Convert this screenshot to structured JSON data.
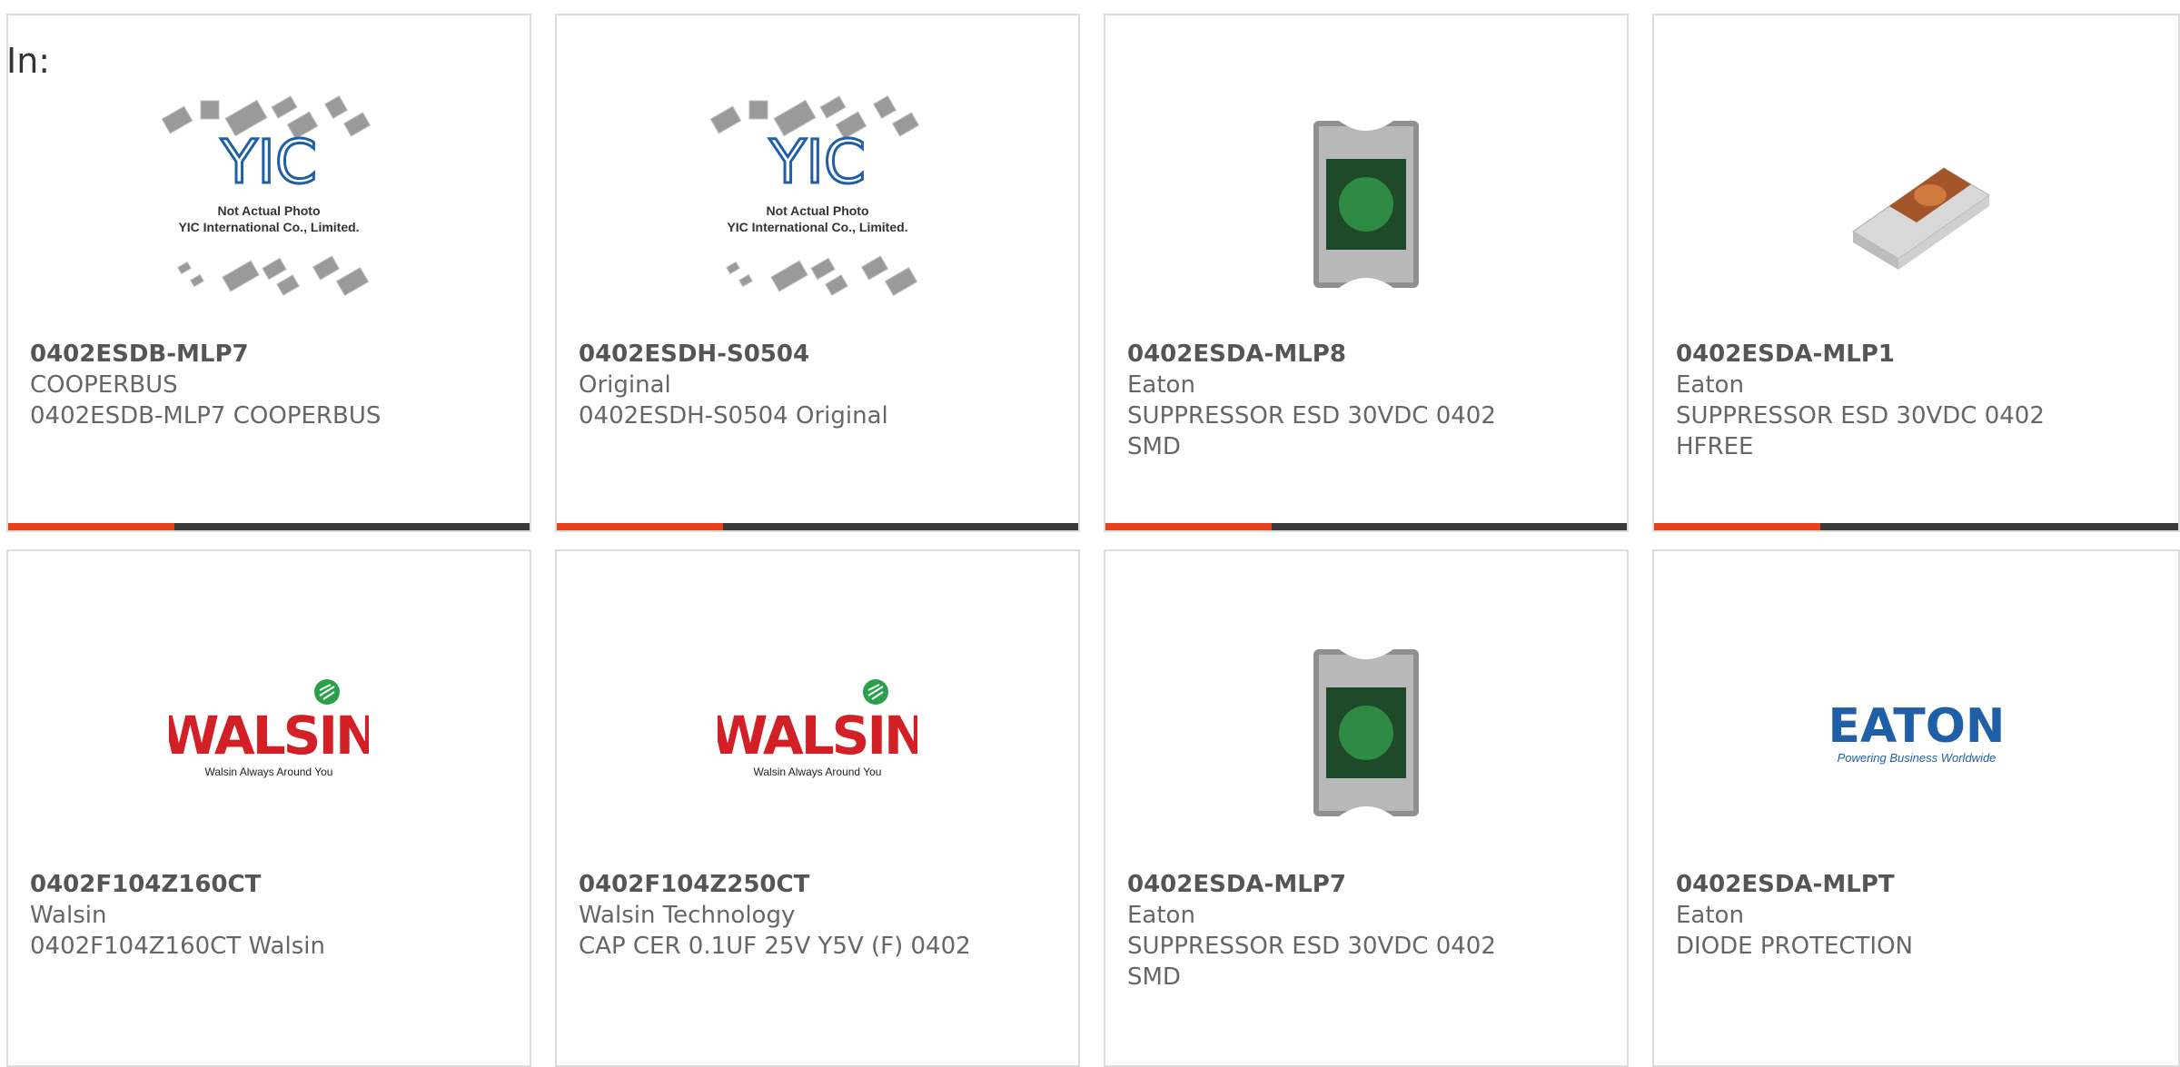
{
  "header": {
    "in_label": "In:"
  },
  "colors": {
    "accent": "#e8401c",
    "bar": "#3a3a3a",
    "border": "#dcdcdc"
  },
  "cards": [
    {
      "part": "0402ESDB-MLP7",
      "maker": "COOPERBUS",
      "desc": "0402ESDB-MLP7 COOPERBUS",
      "image": "yic-placeholder",
      "placeholder_text": [
        "Not Actual Photo",
        "YIC International Co., Limited."
      ]
    },
    {
      "part": "0402ESDH-S0504",
      "maker": "Original",
      "desc": "0402ESDH-S0504 Original",
      "image": "yic-placeholder",
      "placeholder_text": [
        "Not Actual Photo",
        "YIC International Co., Limited."
      ]
    },
    {
      "part": "0402ESDA-MLP8",
      "maker": "Eaton",
      "desc": "SUPPRESSOR ESD 30VDC 0402 SMD",
      "image": "green-chip-photo"
    },
    {
      "part": "0402ESDA-MLP1",
      "maker": "Eaton",
      "desc": "SUPPRESSOR ESD 30VDC 0402 HFREE",
      "image": "orange-chip-photo"
    },
    {
      "part": "0402F104Z160CT",
      "maker": "Walsin",
      "desc": "0402F104Z160CT Walsin",
      "image": "walsin-logo",
      "logo_text": "WALSIN",
      "tagline": "Walsin Always Around You"
    },
    {
      "part": "0402F104Z250CT",
      "maker": "Walsin Technology",
      "desc": "CAP CER 0.1UF 25V Y5V (F) 0402",
      "image": "walsin-logo",
      "logo_text": "WALSIN",
      "tagline": "Walsin Always Around You"
    },
    {
      "part": "0402ESDA-MLP7",
      "maker": "Eaton",
      "desc": "SUPPRESSOR ESD 30VDC 0402 SMD",
      "image": "green-chip-photo"
    },
    {
      "part": "0402ESDA-MLPT",
      "maker": "Eaton",
      "desc": "DIODE PROTECTION",
      "image": "eaton-logo",
      "logo_text": "EATON",
      "tagline": "Powering Business Worldwide"
    }
  ]
}
